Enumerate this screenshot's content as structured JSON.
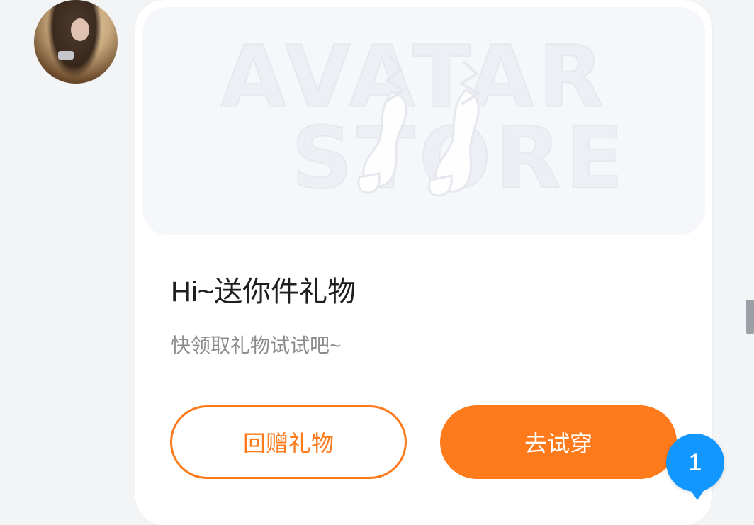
{
  "message": {
    "title": "Hi~送你件礼物",
    "subtitle": "快领取礼物试试吧~"
  },
  "banner": {
    "background_text_line1": "AVATAR",
    "background_text_line2": "STORE"
  },
  "actions": {
    "gift_back_label": "回赠礼物",
    "try_on_label": "去试穿"
  },
  "notification": {
    "count": "1"
  },
  "colors": {
    "accent": "#ff7a1a",
    "badge": "#1296ff",
    "title_text": "#1f1f1f",
    "subtitle_text": "#8c8c8c"
  },
  "icons": {
    "avatar": "user-avatar-photo",
    "badge": "unread-count-badge"
  }
}
